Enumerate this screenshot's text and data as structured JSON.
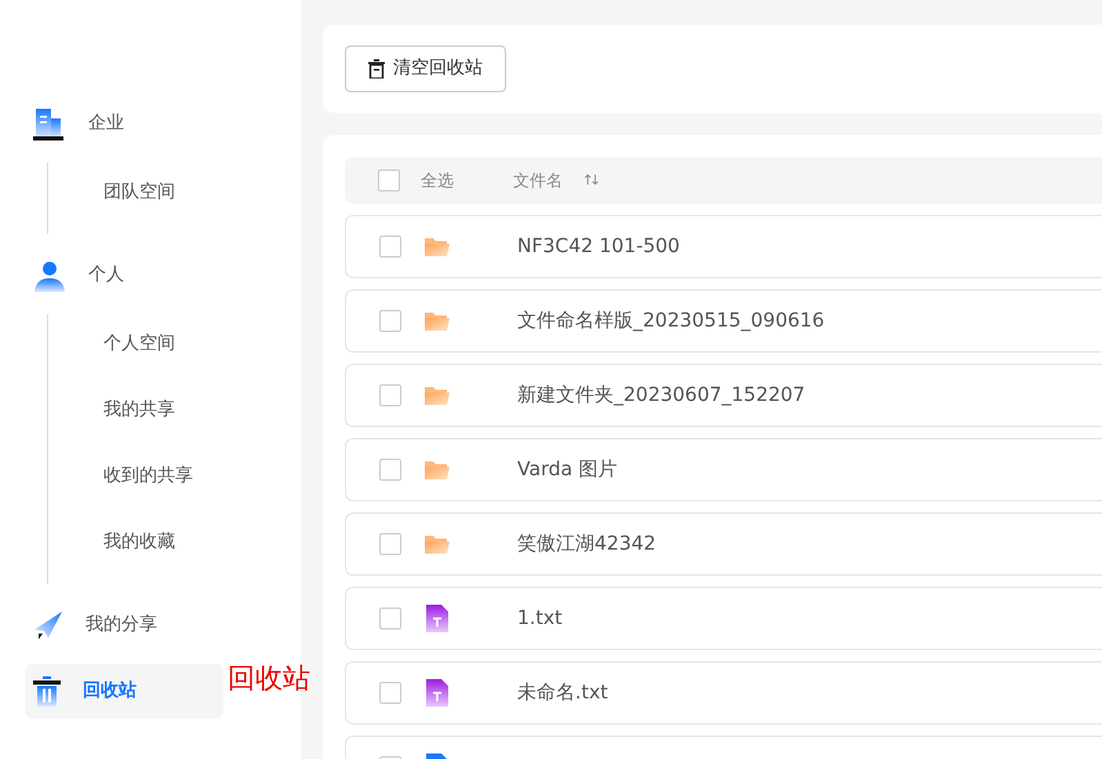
{
  "sidebar": {
    "items": [
      {
        "kind": "group",
        "label": "企业",
        "selected": false,
        "children": [
          {
            "label": "团队空间",
            "selected": false
          }
        ]
      },
      {
        "kind": "group",
        "label": "个人",
        "selected": false,
        "children": [
          {
            "label": "个人空间",
            "selected": false
          },
          {
            "label": "我的共享",
            "selected": false
          },
          {
            "label": "收到的共享",
            "selected": false
          },
          {
            "label": "我的收藏",
            "selected": false
          }
        ]
      },
      {
        "kind": "link",
        "label": "我的分享",
        "selected": false
      },
      {
        "kind": "link",
        "label": "回收站",
        "selected": true
      }
    ]
  },
  "annotation": "回收站",
  "toolbar": {
    "buttons": [
      "清空回收站"
    ]
  },
  "table": {
    "select_all": {
      "label": "全选",
      "checked": false
    },
    "columns": [
      "文件名"
    ],
    "sort_mark": "↑↓",
    "rows": [
      {
        "kind": "folder",
        "name": "NF3C42 101-500",
        "checked": false
      },
      {
        "kind": "folder",
        "name": "文件命名样版_20230515_090616",
        "checked": false
      },
      {
        "kind": "folder",
        "name": "新建文件夹_20230607_152207",
        "checked": false
      },
      {
        "kind": "folder",
        "name": "Varda 图片",
        "checked": false
      },
      {
        "kind": "folder",
        "name": "笑傲江湖42342",
        "checked": false
      },
      {
        "kind": "txt",
        "name": "1.txt",
        "checked": false
      },
      {
        "kind": "txt",
        "name": "未命名.txt",
        "checked": false
      },
      {
        "kind": "doc",
        "checked": false
      }
    ]
  }
}
